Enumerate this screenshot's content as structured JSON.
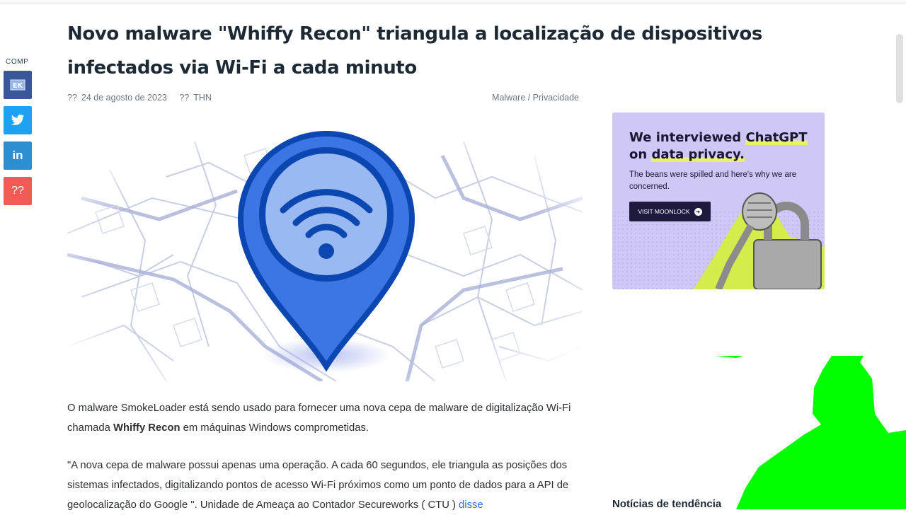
{
  "article": {
    "title": "Novo malware \"Whiffy Recon\" triangula a localização de dispositivos infectados via Wi-Fi a cada minuto",
    "meta": {
      "date_icon": "??",
      "date": "24 de agosto de 2023",
      "author_icon": "??",
      "author": "THN",
      "categories": "Malware / Privacidade"
    },
    "p1_a": "O malware SmokeLoader está sendo usado para fornecer uma nova cepa de malware de digitalização Wi-Fi chamada ",
    "p1_bold": "Whiffy Recon",
    "p1_b": " em máquinas Windows comprometidas.",
    "p2": "\"A nova cepa de malware possui apenas uma operação. A cada 60 segundos, ele triangula as posições dos sistemas infectados, digitalizando pontos de acesso Wi-Fi próximos como um ponto de dados para a API de geolocalização do Google \". Unidade de Ameaça ao Contador Secureworks ( CTU ) ",
    "p2_link": "disse"
  },
  "share": {
    "label": "COMP",
    "buttons": [
      {
        "icon": "share-icon",
        "color": "#3a5898"
      },
      {
        "icon": "twitter-icon",
        "color": "#1da1f2"
      },
      {
        "icon": "linkedin-icon",
        "label": "in",
        "color": "#2d8ecf"
      },
      {
        "icon": "unknown-icon",
        "label": "??",
        "color": "#f25a55"
      }
    ]
  },
  "ad": {
    "headline_1": "We interviewed ",
    "headline_hl1": "ChatGPT",
    "headline_2": "on ",
    "headline_hl2": "data privacy.",
    "subtext": "The beans were spilled and here's why we are concerned.",
    "button": "VISIT MOONLOCK",
    "bg_color": "#cfc7f6",
    "highlight_color": "#e7f26a"
  },
  "sidebar": {
    "trending_heading": "Notícias de tendência"
  },
  "colors": {
    "title": "#1d2a36",
    "link": "#2c6ed5",
    "pin_blue": "#0b47b0",
    "green_overlay": "#00ff00"
  }
}
